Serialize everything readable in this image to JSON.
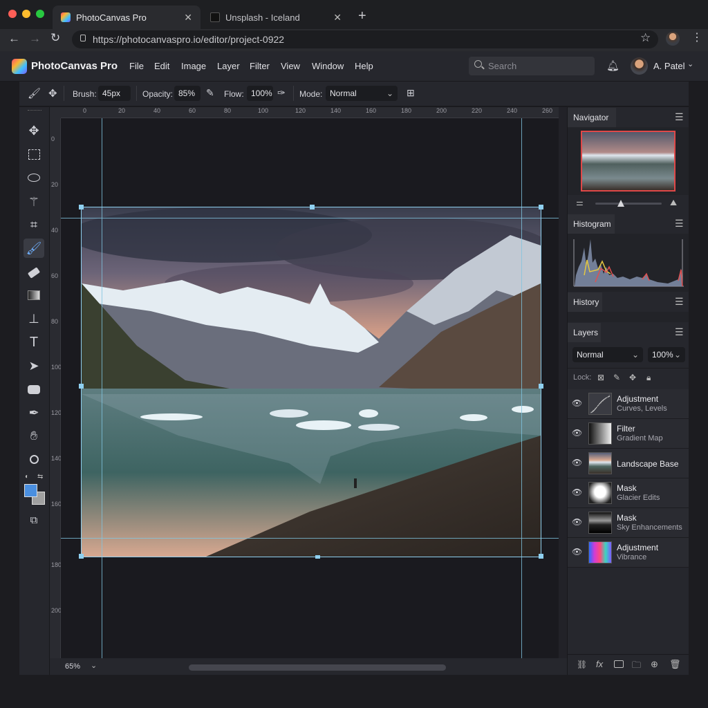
{
  "browser": {
    "tabs": [
      {
        "label": "PhotoCanvas Pro",
        "active": true
      },
      {
        "label": "Unsplash - Iceland",
        "active": false
      }
    ],
    "url": "https://photocanvaspro.io/editor/project-0922"
  },
  "app": {
    "name": "PhotoCanvas Pro",
    "menu": [
      "File",
      "Edit",
      "Image",
      "Layer",
      "Filter",
      "View",
      "Window",
      "Help"
    ],
    "search_placeholder": "Search",
    "user": "A. Patel"
  },
  "options": {
    "brush_label": "Brush:",
    "brush_value": "45px",
    "opacity_label": "Opacity:",
    "opacity_value": "85%",
    "flow_label": "Flow:",
    "flow_value": "100%",
    "mode_label": "Mode:",
    "mode_value": "Normal"
  },
  "rulers": {
    "top": [
      "0",
      "20",
      "40",
      "60",
      "80",
      "100",
      "120",
      "140",
      "160",
      "180",
      "200",
      "220",
      "240",
      "260"
    ],
    "left": [
      "0",
      "20",
      "40",
      "60",
      "80",
      "100",
      "120",
      "140",
      "160",
      "180",
      "200"
    ]
  },
  "status": {
    "zoom": "65%"
  },
  "panels": {
    "navigator": "Navigator",
    "histogram": "Histogram",
    "history": "History",
    "layers": "Layers",
    "blend_mode": "Normal",
    "layer_opacity": "100%",
    "lock_label": "Lock:"
  },
  "layers": [
    {
      "name": "Adjustment",
      "sub": "Curves, Levels",
      "thumb": "curves"
    },
    {
      "name": "Filter",
      "sub": "Gradient Map",
      "thumb": "gradient"
    },
    {
      "name": "Landscape Base",
      "sub": "",
      "thumb": "photo"
    },
    {
      "name": "Mask",
      "sub": "Glacier Edits",
      "thumb": "mask"
    },
    {
      "name": "Mask",
      "sub": "Sky Enhancements",
      "thumb": "mask2"
    },
    {
      "name": "Adjustment",
      "sub": "Vibrance",
      "thumb": "vibrance"
    }
  ],
  "colors": {
    "accent": "#4a90e2",
    "foreground": "#4a8fe0",
    "background": "#a0a0a0"
  }
}
